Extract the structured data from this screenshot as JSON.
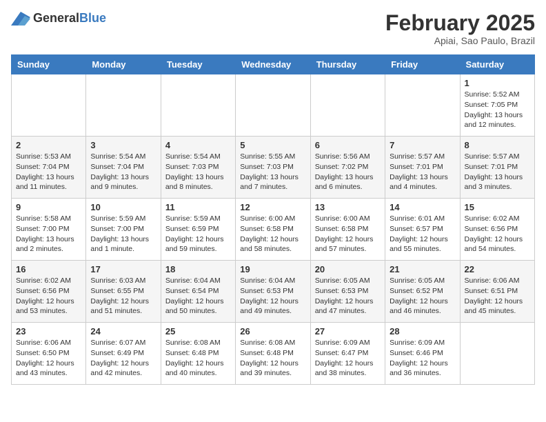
{
  "header": {
    "logo_general": "General",
    "logo_blue": "Blue",
    "month_year": "February 2025",
    "location": "Apiai, Sao Paulo, Brazil"
  },
  "weekdays": [
    "Sunday",
    "Monday",
    "Tuesday",
    "Wednesday",
    "Thursday",
    "Friday",
    "Saturday"
  ],
  "weeks": [
    [
      {
        "day": "",
        "info": ""
      },
      {
        "day": "",
        "info": ""
      },
      {
        "day": "",
        "info": ""
      },
      {
        "day": "",
        "info": ""
      },
      {
        "day": "",
        "info": ""
      },
      {
        "day": "",
        "info": ""
      },
      {
        "day": "1",
        "info": "Sunrise: 5:52 AM\nSunset: 7:05 PM\nDaylight: 13 hours and 12 minutes."
      }
    ],
    [
      {
        "day": "2",
        "info": "Sunrise: 5:53 AM\nSunset: 7:04 PM\nDaylight: 13 hours and 11 minutes."
      },
      {
        "day": "3",
        "info": "Sunrise: 5:54 AM\nSunset: 7:04 PM\nDaylight: 13 hours and 9 minutes."
      },
      {
        "day": "4",
        "info": "Sunrise: 5:54 AM\nSunset: 7:03 PM\nDaylight: 13 hours and 8 minutes."
      },
      {
        "day": "5",
        "info": "Sunrise: 5:55 AM\nSunset: 7:03 PM\nDaylight: 13 hours and 7 minutes."
      },
      {
        "day": "6",
        "info": "Sunrise: 5:56 AM\nSunset: 7:02 PM\nDaylight: 13 hours and 6 minutes."
      },
      {
        "day": "7",
        "info": "Sunrise: 5:57 AM\nSunset: 7:01 PM\nDaylight: 13 hours and 4 minutes."
      },
      {
        "day": "8",
        "info": "Sunrise: 5:57 AM\nSunset: 7:01 PM\nDaylight: 13 hours and 3 minutes."
      }
    ],
    [
      {
        "day": "9",
        "info": "Sunrise: 5:58 AM\nSunset: 7:00 PM\nDaylight: 13 hours and 2 minutes."
      },
      {
        "day": "10",
        "info": "Sunrise: 5:59 AM\nSunset: 7:00 PM\nDaylight: 13 hours and 1 minute."
      },
      {
        "day": "11",
        "info": "Sunrise: 5:59 AM\nSunset: 6:59 PM\nDaylight: 12 hours and 59 minutes."
      },
      {
        "day": "12",
        "info": "Sunrise: 6:00 AM\nSunset: 6:58 PM\nDaylight: 12 hours and 58 minutes."
      },
      {
        "day": "13",
        "info": "Sunrise: 6:00 AM\nSunset: 6:58 PM\nDaylight: 12 hours and 57 minutes."
      },
      {
        "day": "14",
        "info": "Sunrise: 6:01 AM\nSunset: 6:57 PM\nDaylight: 12 hours and 55 minutes."
      },
      {
        "day": "15",
        "info": "Sunrise: 6:02 AM\nSunset: 6:56 PM\nDaylight: 12 hours and 54 minutes."
      }
    ],
    [
      {
        "day": "16",
        "info": "Sunrise: 6:02 AM\nSunset: 6:56 PM\nDaylight: 12 hours and 53 minutes."
      },
      {
        "day": "17",
        "info": "Sunrise: 6:03 AM\nSunset: 6:55 PM\nDaylight: 12 hours and 51 minutes."
      },
      {
        "day": "18",
        "info": "Sunrise: 6:04 AM\nSunset: 6:54 PM\nDaylight: 12 hours and 50 minutes."
      },
      {
        "day": "19",
        "info": "Sunrise: 6:04 AM\nSunset: 6:53 PM\nDaylight: 12 hours and 49 minutes."
      },
      {
        "day": "20",
        "info": "Sunrise: 6:05 AM\nSunset: 6:53 PM\nDaylight: 12 hours and 47 minutes."
      },
      {
        "day": "21",
        "info": "Sunrise: 6:05 AM\nSunset: 6:52 PM\nDaylight: 12 hours and 46 minutes."
      },
      {
        "day": "22",
        "info": "Sunrise: 6:06 AM\nSunset: 6:51 PM\nDaylight: 12 hours and 45 minutes."
      }
    ],
    [
      {
        "day": "23",
        "info": "Sunrise: 6:06 AM\nSunset: 6:50 PM\nDaylight: 12 hours and 43 minutes."
      },
      {
        "day": "24",
        "info": "Sunrise: 6:07 AM\nSunset: 6:49 PM\nDaylight: 12 hours and 42 minutes."
      },
      {
        "day": "25",
        "info": "Sunrise: 6:08 AM\nSunset: 6:48 PM\nDaylight: 12 hours and 40 minutes."
      },
      {
        "day": "26",
        "info": "Sunrise: 6:08 AM\nSunset: 6:48 PM\nDaylight: 12 hours and 39 minutes."
      },
      {
        "day": "27",
        "info": "Sunrise: 6:09 AM\nSunset: 6:47 PM\nDaylight: 12 hours and 38 minutes."
      },
      {
        "day": "28",
        "info": "Sunrise: 6:09 AM\nSunset: 6:46 PM\nDaylight: 12 hours and 36 minutes."
      },
      {
        "day": "",
        "info": ""
      }
    ]
  ]
}
